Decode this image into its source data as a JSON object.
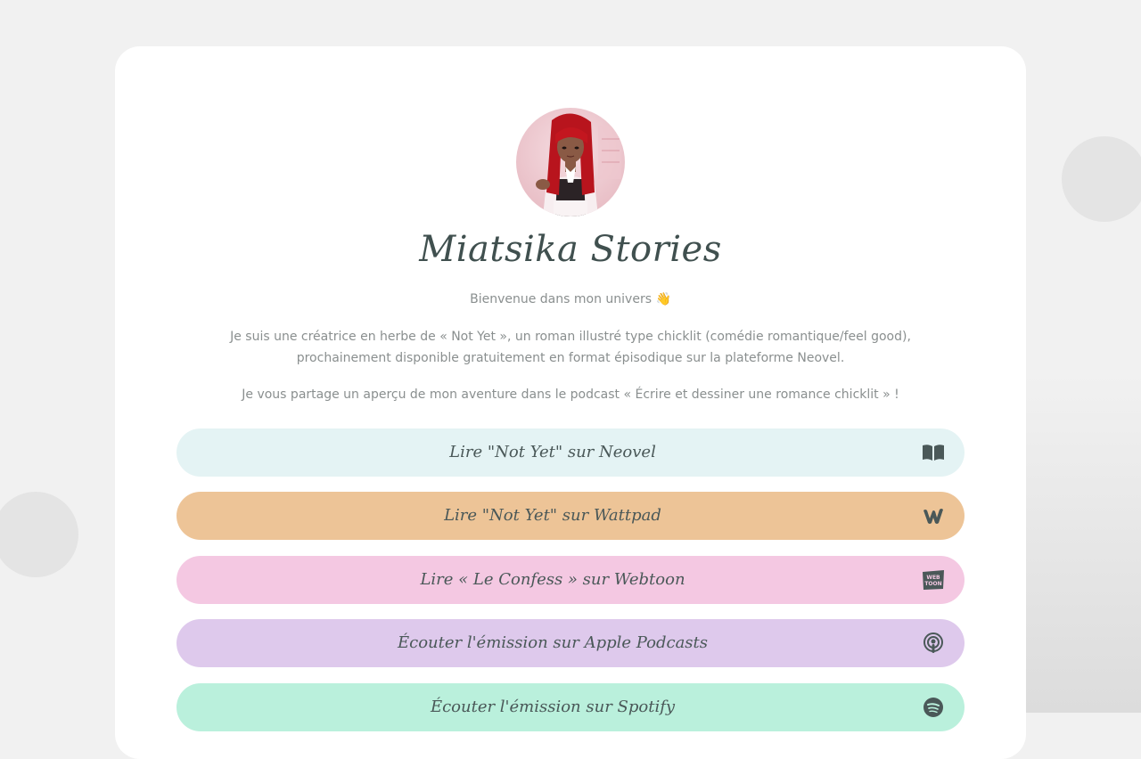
{
  "profile": {
    "title": "Miatsika Stories",
    "avatar_alt": "avatar"
  },
  "intro": {
    "welcome": "Bienvenue dans mon univers 👋",
    "description_line1": "Je suis une créatrice en herbe de « Not Yet », un roman illustré type chicklit (comédie romantique/feel good),",
    "description_line2": "prochainement disponible gratuitement en format épisodique sur la plateforme Neovel.",
    "podcast": "Je vous partage un aperçu de mon aventure dans le podcast « Écrire et dessiner une romance chicklit » !"
  },
  "links": [
    {
      "label": "Lire \"Not Yet\" sur Neovel",
      "icon": "book-icon",
      "color": "#e4f3f4"
    },
    {
      "label": "Lire \"Not Yet\" sur Wattpad",
      "icon": "wattpad-icon",
      "color": "#edc497"
    },
    {
      "label": "Lire « Le Confess » sur Webtoon",
      "icon": "webtoon-icon",
      "color": "#f4c8e2"
    },
    {
      "label": "Écouter l'émission sur Apple Podcasts",
      "icon": "podcast-icon",
      "color": "#dec9ec"
    },
    {
      "label": "Écouter l'émission sur Spotify",
      "icon": "spotify-icon",
      "color": "#baf0dc"
    }
  ],
  "icons": {
    "webtoon_text_top": "WEB",
    "webtoon_text_bottom": "TOON"
  }
}
